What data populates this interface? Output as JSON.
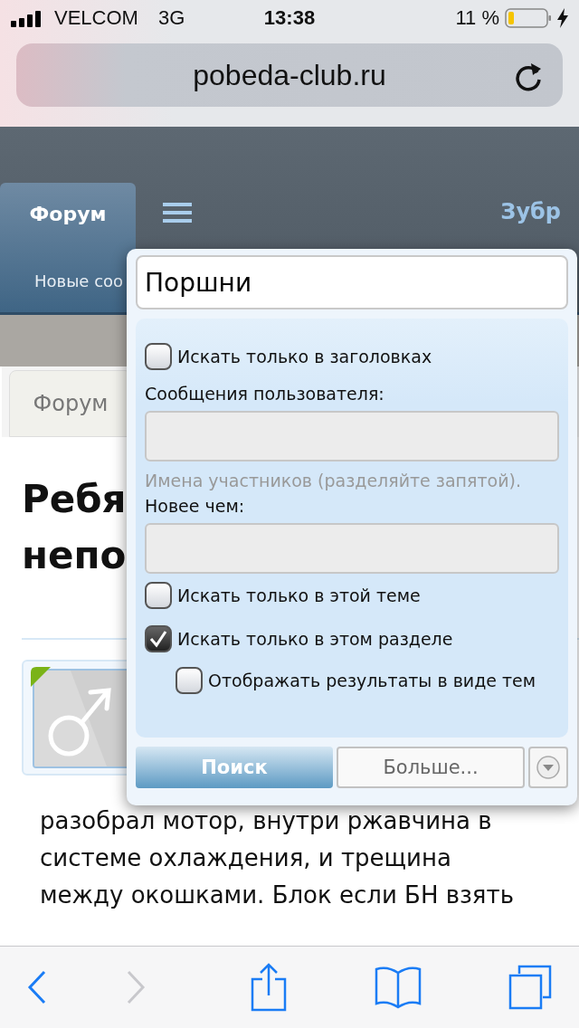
{
  "status_bar": {
    "carrier": "VELCOM",
    "network": "3G",
    "time": "13:38",
    "battery": "11 %"
  },
  "address_bar": {
    "url": "pobeda-club.ru"
  },
  "site_nav": {
    "tabs": [
      {
        "label": "Форум",
        "selected": true
      }
    ],
    "user": "Зубр",
    "subnav": "Новые соо"
  },
  "breadcrumb": {
    "label": "Форум"
  },
  "thread": {
    "title_lines": [
      "Ребя",
      "непо"
    ],
    "body": "разобрал мотор, внутри ржавчина в системе охлаждения, и трещина между окошками. Блок если БН взять"
  },
  "search_popup": {
    "query": "Поршни",
    "options": [
      {
        "kind": "checkbox",
        "label": "Искать только в заголовках",
        "checked": false
      },
      {
        "kind": "field",
        "label": "Сообщения пользователя:",
        "hint": "Имена участников (разделяйте запятой)."
      },
      {
        "kind": "field",
        "label": "Новее чем:"
      },
      {
        "kind": "checkbox",
        "label": "Искать только в этой теме",
        "checked": false
      },
      {
        "kind": "checkbox",
        "label": "Искать только в этом разделе",
        "checked": true
      },
      {
        "kind": "subcheckbox",
        "label": "Отображать результаты в виде тем",
        "checked": false
      }
    ],
    "buttons": [
      {
        "kind": "primary",
        "label": "Поиск"
      },
      {
        "kind": "secondary",
        "label": "Больше..."
      }
    ]
  }
}
